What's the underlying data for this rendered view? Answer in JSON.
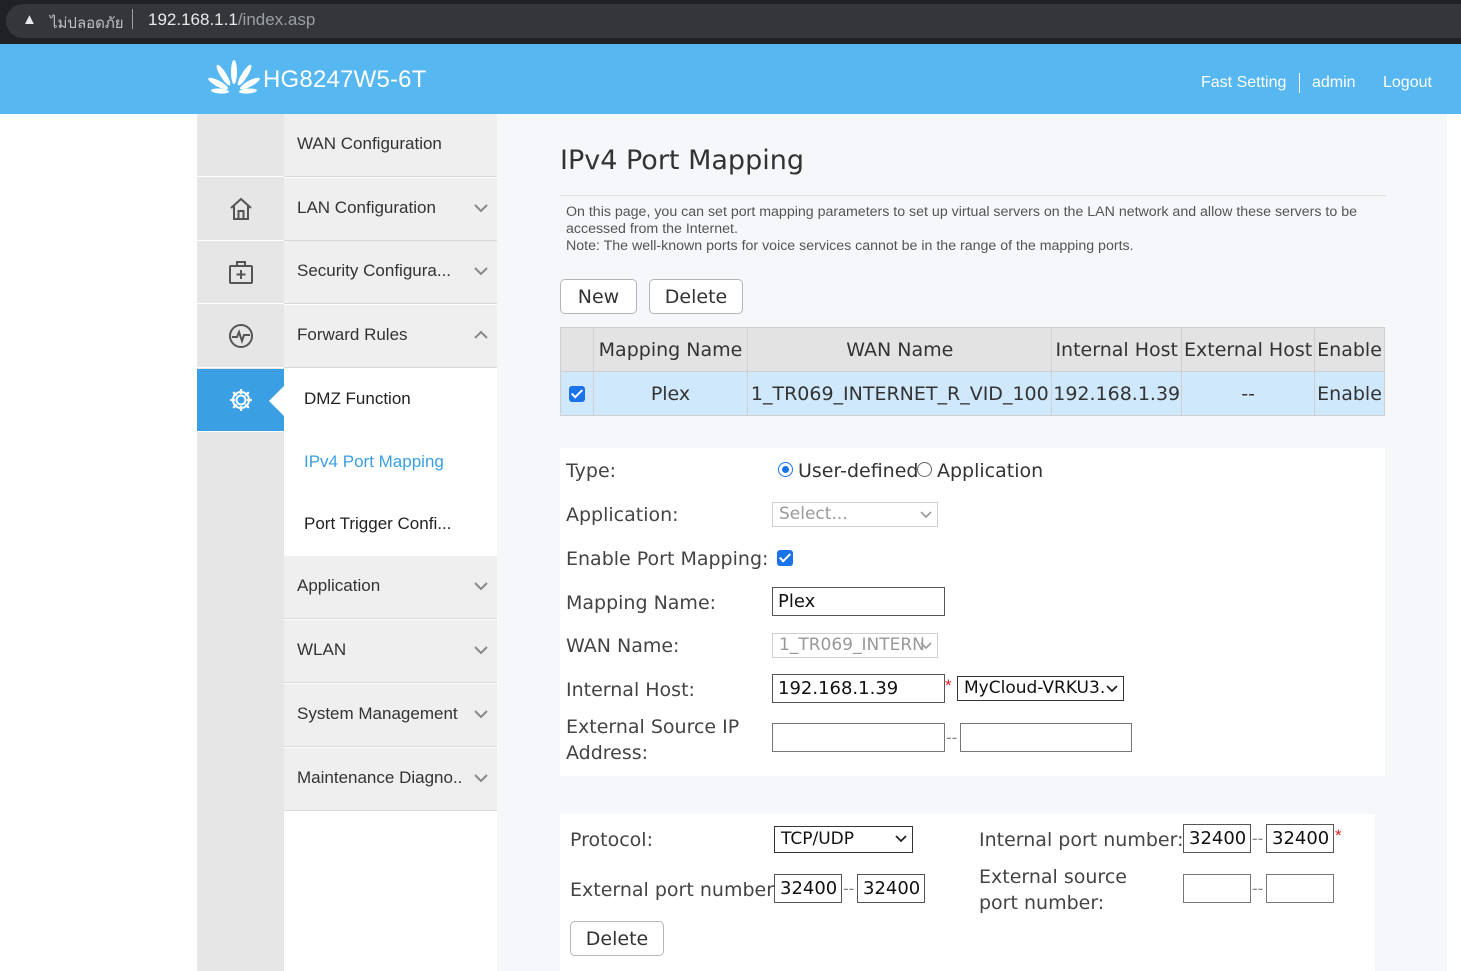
{
  "browser": {
    "insecure_label": "ไม่ปลอดภัย",
    "url_host": "192.168.1.1",
    "url_path": "/index.asp"
  },
  "header": {
    "model": "HG8247W5-6T",
    "fast_setting": "Fast Setting",
    "user": "admin",
    "logout": "Logout",
    "bg_color": "#56b7f1"
  },
  "icons": [
    "home-icon",
    "first-aid-icon",
    "pulse-icon",
    "gear-icon"
  ],
  "menu": {
    "wan": "WAN Configuration",
    "lan": "LAN Configuration",
    "security": "Security Configura...",
    "forward": "Forward Rules",
    "dmz": "DMZ Function",
    "ipv4": "IPv4 Port Mapping",
    "trigger": "Port Trigger Confi...",
    "application": "Application",
    "wlan": "WLAN",
    "system": "System Management",
    "maintenance": "Maintenance Diagno.."
  },
  "page": {
    "title": "IPv4 Port Mapping",
    "desc1": "On this page, you can set port mapping parameters to set up virtual servers on the LAN network and allow these servers to be accessed from the Internet.",
    "desc2": "Note: The well-known ports for voice services cannot be in the range of the mapping ports.",
    "new_button": "New",
    "delete_button": "Delete"
  },
  "table": {
    "headers": [
      "Mapping Name",
      "WAN Name",
      "Internal Host",
      "External Host",
      "Enable"
    ],
    "rows": [
      {
        "checked": true,
        "mapping_name": "Plex",
        "wan_name": "1_TR069_INTERNET_R_VID_100",
        "internal_host": "192.168.1.39",
        "external_host": "--",
        "enable": "Enable"
      }
    ]
  },
  "form": {
    "type_label": "Type:",
    "type_user": "User-defined",
    "type_app": "Application",
    "type_selected": "User-defined",
    "application_label": "Application:",
    "application_value": "Select...",
    "enable_label": "Enable Port Mapping:",
    "enable_checked": true,
    "mapping_name_label": "Mapping Name:",
    "mapping_name_value": "Plex",
    "wan_name_label": "WAN Name:",
    "wan_name_value": "1_TR069_INTERN",
    "internal_host_label": "Internal Host:",
    "internal_host_value": "192.168.1.39",
    "internal_host_device": "MyCloud-VRKU3.",
    "ext_src_ip_label": "External Source IP Address:",
    "ext_src_ip_start": "",
    "ext_src_ip_end": ""
  },
  "ports": {
    "protocol_label": "Protocol:",
    "protocol_value": "TCP/UDP",
    "internal_port_label": "Internal port number:",
    "internal_port_start": "32400",
    "internal_port_end": "32400",
    "external_port_label": "External port number:",
    "external_port_start": "32400",
    "external_port_end": "32400",
    "ext_src_port_label": "External source port number:",
    "ext_src_port_start": "",
    "ext_src_port_end": "",
    "delete_button": "Delete",
    "range_sep": "--",
    "required_mark": "*"
  }
}
